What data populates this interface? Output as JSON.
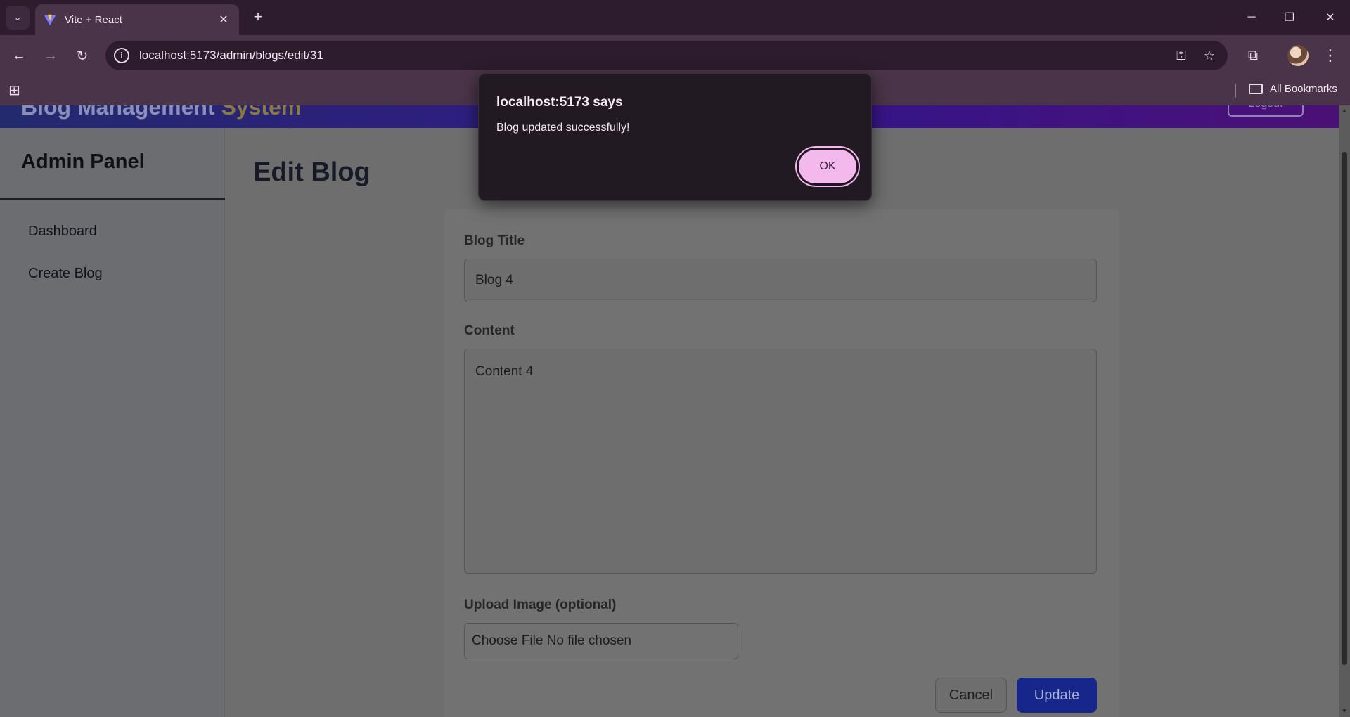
{
  "browser": {
    "tab_title": "Vite + React",
    "url": "localhost:5173/admin/blogs/edit/31",
    "bookmarks_label": "All Bookmarks"
  },
  "app": {
    "brand_part1": "Blog Management ",
    "brand_part2": "System",
    "logout_label": "Logout"
  },
  "sidebar": {
    "title": "Admin Panel",
    "items": [
      {
        "label": "Dashboard"
      },
      {
        "label": "Create Blog"
      }
    ]
  },
  "main": {
    "title": "Edit Blog",
    "form": {
      "title_label": "Blog Title",
      "title_value": "Blog 4",
      "content_label": "Content",
      "content_value": "Content 4",
      "image_label": "Upload Image (optional)",
      "file_input_text": "Choose File No file chosen",
      "cancel_label": "Cancel",
      "update_label": "Update"
    }
  },
  "dialog": {
    "title": "localhost:5173 says",
    "message": "Blog updated successfully!",
    "ok_label": "OK"
  },
  "colors": {
    "accent_dialog_button": "#f3b9ec",
    "update_button": "#17268a",
    "header_gradient_start": "#242a6e",
    "header_gradient_end": "#4b1076"
  }
}
